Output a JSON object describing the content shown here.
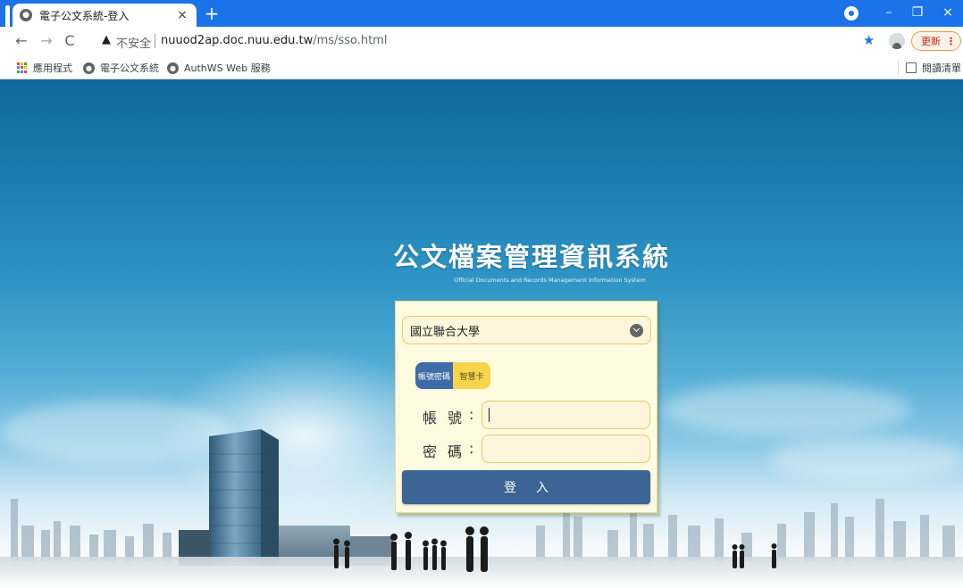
{
  "browser": {
    "tab": {
      "title": "電子公文系統-登入",
      "close_label": "×"
    },
    "new_tab_label": "+",
    "window_controls": {
      "minimize": "–",
      "restore": "❐",
      "close": "×"
    },
    "toolbar": {
      "back_icon": "back-arrow-icon",
      "forward_icon": "forward-arrow-icon",
      "reload_icon": "reload-icon",
      "security_warning": "不安全",
      "url_host": "nuuod2ap.doc.nuu.edu.tw",
      "url_path": "/ms/sso.html",
      "update_label": "更新",
      "update_menu": "⋮"
    },
    "bookmarks": [
      {
        "label": "應用程式",
        "icon": "apps-grid-icon"
      },
      {
        "label": "電子公文系統",
        "icon": "globe-icon"
      },
      {
        "label": "AuthWS Web 服務",
        "icon": "globe-icon"
      }
    ],
    "reading_list_label": "閱讀清單",
    "colors": {
      "accent": "#1a73e8",
      "update": "#f2994a"
    }
  },
  "page": {
    "title": "公文檔案管理資訊系統",
    "subtitle": "Official Documents and Records Management Information System",
    "login": {
      "organization_selected": "國立聯合大學",
      "tabs": [
        {
          "label": "帳號密碼",
          "active": true
        },
        {
          "label": "智慧卡",
          "active": false
        }
      ],
      "account_label": "帳號",
      "password_label": "密碼",
      "colon": ":",
      "account_value": "",
      "password_value": "",
      "submit_label": "登入"
    },
    "colors": {
      "button": "#3a6594",
      "panel": "#fffbe0",
      "tab_active": "#3f6ba8",
      "tab_inactive": "#f6d44c"
    }
  }
}
